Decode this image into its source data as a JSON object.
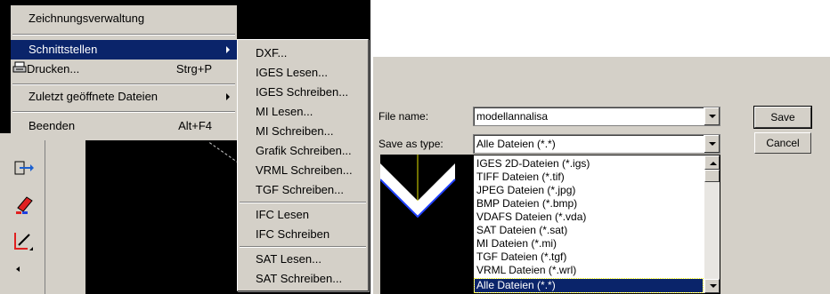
{
  "file_menu": {
    "items": [
      {
        "label": "Zeichnungsverwaltung"
      },
      {
        "label": "Schnittstellen"
      },
      {
        "label": "Drucken...",
        "shortcut": "Strg+P"
      },
      {
        "label": "Zuletzt geöffnete Dateien"
      },
      {
        "label": "Beenden",
        "shortcut": "Alt+F4"
      }
    ]
  },
  "submenu": {
    "items": [
      "DXF...",
      "IGES Lesen...",
      "IGES Schreiben...",
      "MI Lesen...",
      "MI Schreiben...",
      "Grafik Schreiben...",
      "VRML Schreiben...",
      "TGF Schreiben...",
      "IFC Lesen",
      "IFC Schreiben",
      "SAT Lesen...",
      "SAT Schreiben..."
    ]
  },
  "save_dialog": {
    "file_name_label": "File name:",
    "file_name_value": "modellannalisa",
    "save_as_type_label": "Save as type:",
    "save_as_type_value": "Alle Dateien (*.*)",
    "save_button": "Save",
    "cancel_button": "Cancel",
    "type_options": [
      "IGES 2D-Dateien (*.igs)",
      "TIFF Dateien (*.tif)",
      "JPEG Dateien (*.jpg)",
      "BMP Dateien (*.bmp)",
      "VDAFS Dateien (*.vda)",
      "SAT Dateien (*.sat)",
      "MI Dateien (*.mi)",
      "TGF Dateien (*.tgf)",
      "VRML Dateien (*.wrl)",
      "Alle Dateien (*.*)"
    ],
    "selected_option_index": 9
  },
  "icons": [
    "printer-icon",
    "import-tool-icon",
    "eraser-icon",
    "pen-tool-icon",
    "scroll-left-icon"
  ],
  "colors": {
    "menu_bg": "#d4d0c8",
    "highlight": "#0a246a",
    "canvas": "#000000"
  }
}
